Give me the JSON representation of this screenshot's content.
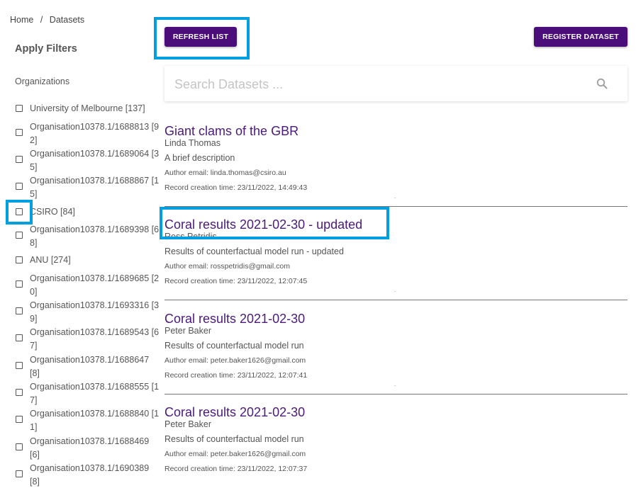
{
  "breadcrumb": {
    "home": "Home",
    "separator": "/",
    "current": "Datasets"
  },
  "filters": {
    "title": "Apply Filters",
    "organizations_heading": "Organizations"
  },
  "organizations": [
    {
      "label": "University of Melbourne [137]",
      "checked": false
    },
    {
      "label": "Organisation10378.1/1688813 [92]",
      "checked": false
    },
    {
      "label": "Organisation10378.1/1689064 [35]",
      "checked": false
    },
    {
      "label": "Organisation10378.1/1688867 [15]",
      "checked": false
    },
    {
      "label": "CSIRO [84]",
      "checked": false
    },
    {
      "label": "Organisation10378.1/1689398 [68]",
      "checked": false
    },
    {
      "label": "ANU [274]",
      "checked": false
    },
    {
      "label": "Organisation10378.1/1689685 [20]",
      "checked": false
    },
    {
      "label": "Organisation10378.1/1693316 [39]",
      "checked": false
    },
    {
      "label": "Organisation10378.1/1689543 [67]",
      "checked": false
    },
    {
      "label": "Organisation10378.1/1688647 [8]",
      "checked": false
    },
    {
      "label": "Organisation10378.1/1688555 [17]",
      "checked": false
    },
    {
      "label": "Organisation10378.1/1688840 [11]",
      "checked": false
    },
    {
      "label": "Organisation10378.1/1688469 [6]",
      "checked": false
    },
    {
      "label": "Organisation10378.1/1690389 [8]",
      "checked": false
    }
  ],
  "toolbar": {
    "refresh_label": "REFRESH LIST",
    "register_label": "REGISTER DATASET"
  },
  "search": {
    "placeholder": "Search Datasets ...",
    "value": ""
  },
  "results": [
    {
      "title": "Giant clams of the GBR",
      "author": "Linda Thomas",
      "description": "A brief description",
      "email": "Author email: linda.thomas@csiro.au",
      "created": "Record creation time: 23/11/2022, 14:49:43"
    },
    {
      "title": "Coral results 2021-02-30 - updated",
      "author": "Ross Petridis",
      "description": "Results of counterfactual model run - updated",
      "email": "Author email: rosspetridis@gmail.com",
      "created": "Record creation time: 23/11/2022, 12:07:45"
    },
    {
      "title": "Coral results 2021-02-30",
      "author": "Peter Baker",
      "description": "Results of counterfactual model run",
      "email": "Author email: peter.baker1626@gmail.com",
      "created": "Record creation time: 23/11/2022, 12:07:41"
    },
    {
      "title": "Coral results 2021-02-30",
      "author": "Peter Baker",
      "description": "Results of counterfactual model run",
      "email": "Author email: peter.baker1626@gmail.com",
      "created": "Record creation time: 23/11/2022, 12:07:37"
    }
  ],
  "colors": {
    "accent": "#4b0d79",
    "title_text": "#4b1a7a",
    "highlight": "#00a0e0"
  }
}
